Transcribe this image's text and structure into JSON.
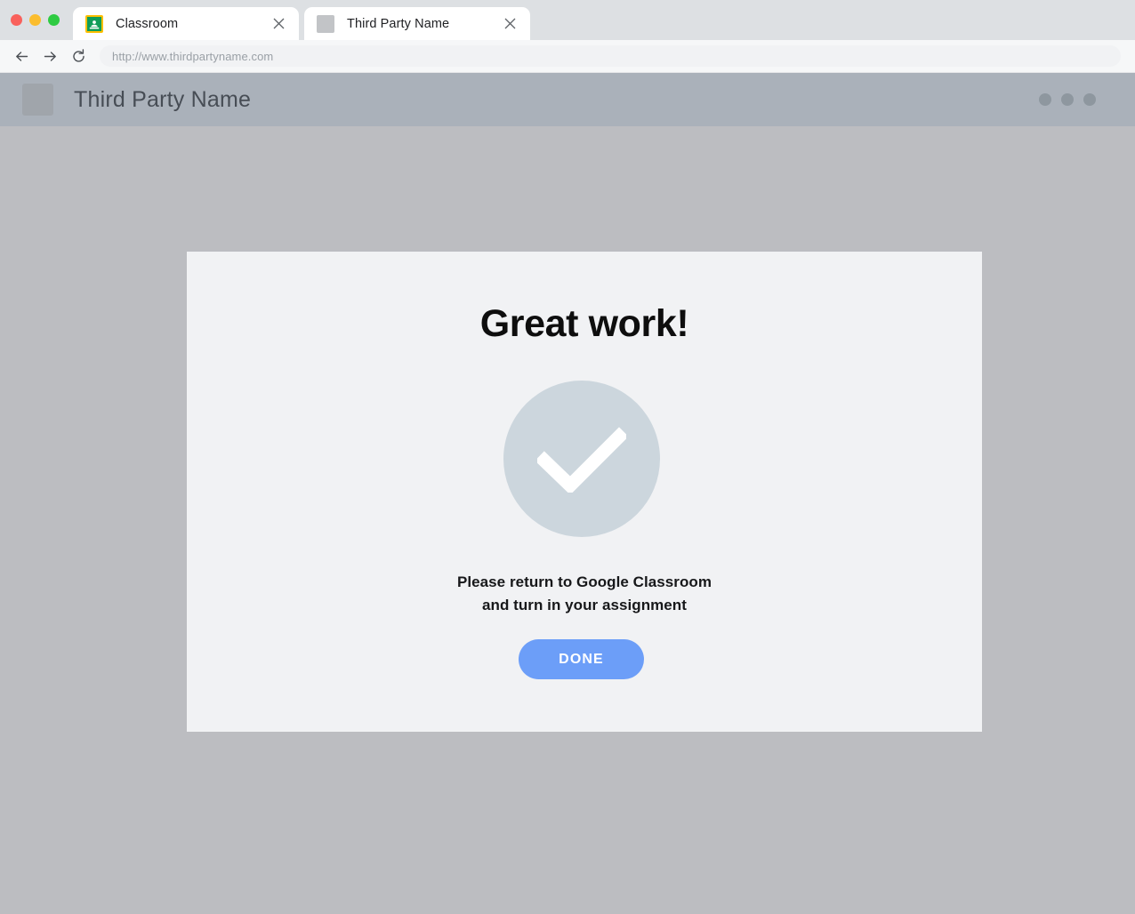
{
  "window": {
    "traffic_lights": [
      {
        "name": "close",
        "color": "#f9615c"
      },
      {
        "name": "minimize",
        "color": "#fbbd2e"
      },
      {
        "name": "maximize",
        "color": "#2ecb42"
      }
    ]
  },
  "browser": {
    "tabs": [
      {
        "title": "Classroom",
        "favicon": "google-classroom-icon",
        "close_label": "×",
        "active": false
      },
      {
        "title": "Third Party Name",
        "favicon": "placeholder-square-icon",
        "close_label": "×",
        "active": true
      }
    ],
    "toolbar": {
      "back_icon": "back-arrow-icon",
      "forward_icon": "forward-arrow-icon",
      "reload_icon": "reload-icon",
      "url": "http://www.thirdpartyname.com"
    }
  },
  "site": {
    "header": {
      "logo": "placeholder-logo-icon",
      "title": "Third Party Name",
      "menu_dots": 3
    },
    "card": {
      "heading": "Great work!",
      "status_icon": "checkmark-circle-icon",
      "message_line_1": "Please return to Google Classroom",
      "message_line_2": "and turn in your assignment",
      "done_label": "DONE"
    }
  },
  "colors": {
    "page_background": "#bcbdc1",
    "card_background": "#f1f2f4",
    "site_header": "#aab1ba",
    "tabstrip": "#dde0e3",
    "check_circle": "#ccd6dd",
    "done_button": "#6c9ef8",
    "heading_text": "#0e0e0e"
  }
}
